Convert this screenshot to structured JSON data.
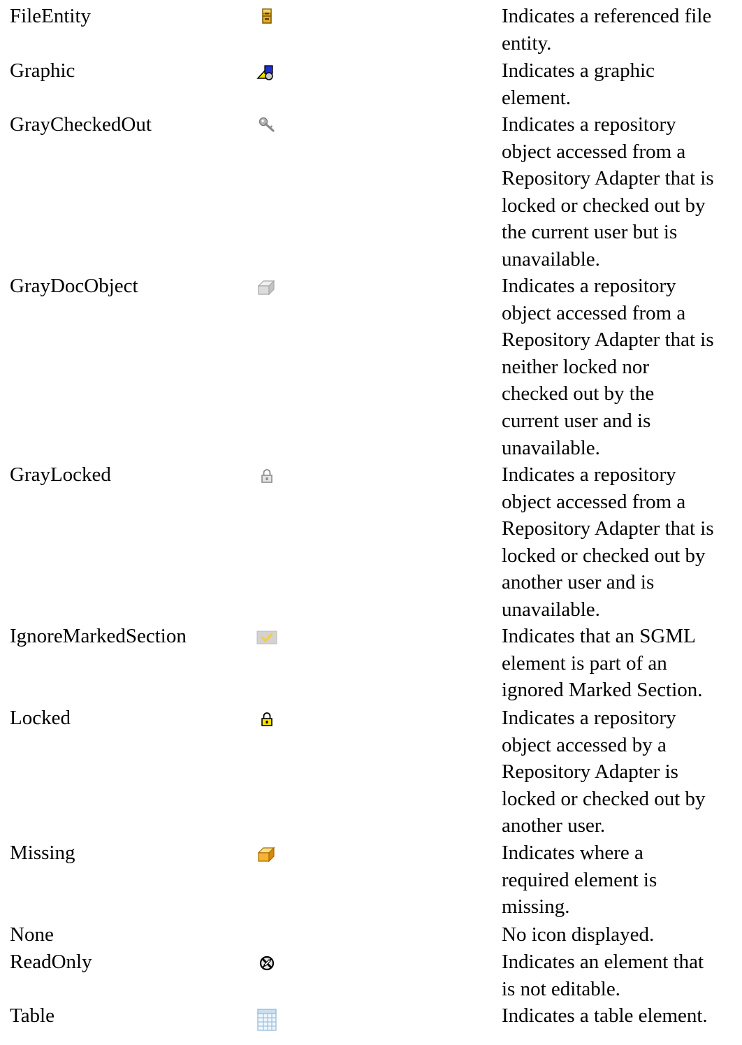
{
  "rows": [
    {
      "name": "FileEntity",
      "icon": "file-cabinet-icon",
      "description_lines": [
        "Indicates a referenced file",
        "entity."
      ]
    },
    {
      "name": "Graphic",
      "icon": "graphic-shapes-icon",
      "description_lines": [
        "Indicates a graphic",
        "element."
      ]
    },
    {
      "name": "GrayCheckedOut",
      "icon": "gray-key-icon",
      "description_lines": [
        "Indicates a repository",
        "object accessed from a",
        "Repository Adapter that is",
        "locked or checked out by",
        "the current user but is",
        "unavailable."
      ]
    },
    {
      "name": "GrayDocObject",
      "icon": "gray-cube-icon",
      "description_lines": [
        "Indicates a repository",
        "object accessed from a",
        "Repository Adapter that is",
        "neither locked nor",
        "checked out by the",
        "current user and is",
        "unavailable."
      ]
    },
    {
      "name": "GrayLocked",
      "icon": "gray-lock-icon",
      "description_lines": [
        "Indicates a repository",
        "object accessed from a",
        "Repository Adapter that is",
        "locked or checked out by",
        "another user and is",
        "unavailable."
      ]
    },
    {
      "name": "IgnoreMarkedSection",
      "icon": "gray-checkmark-icon",
      "description_lines": [
        "Indicates that an SGML",
        "element is part of an",
        "ignored Marked Section."
      ]
    },
    {
      "name": "Locked",
      "icon": "yellow-lock-icon",
      "description_lines": [
        "Indicates a repository",
        "object accessed by a",
        "Repository Adapter is",
        "locked or checked out by",
        "another user."
      ]
    },
    {
      "name": "Missing",
      "icon": "orange-cube-icon",
      "description_lines": [
        "Indicates where a",
        "required element is",
        "missing."
      ]
    },
    {
      "name": "None",
      "icon": "",
      "description_lines": [
        "No icon displayed."
      ]
    },
    {
      "name": "ReadOnly",
      "icon": "crossed-pencil-icon",
      "description_lines": [
        "Indicates an element that",
        "is not editable."
      ]
    },
    {
      "name": "Table",
      "icon": "table-grid-icon",
      "description_lines": [
        "Indicates a table element."
      ]
    }
  ]
}
